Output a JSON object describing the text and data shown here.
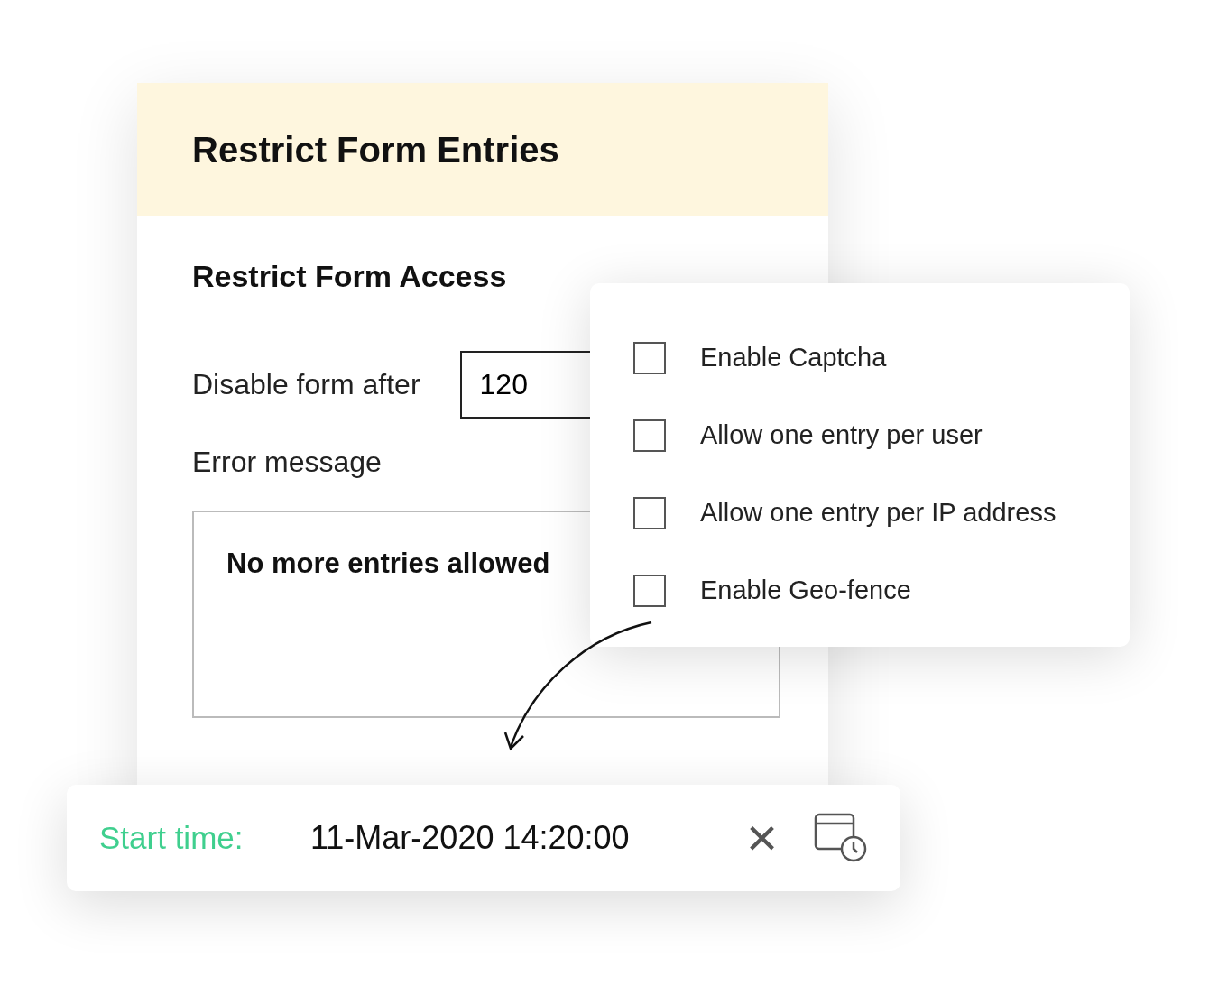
{
  "form_card": {
    "title": "Restrict Form Entries",
    "section_title": "Restrict Form Access",
    "limit_label": "Disable form after",
    "limit_value": "120",
    "error_label": "Error message",
    "error_value": "No more entries allowed"
  },
  "options": [
    {
      "label": "Enable Captcha",
      "checked": false
    },
    {
      "label": "Allow one entry per user",
      "checked": false
    },
    {
      "label": "Allow one entry per IP address",
      "checked": false
    },
    {
      "label": "Enable Geo-fence",
      "checked": false
    }
  ],
  "start_time": {
    "label": "Start time:",
    "value": "11-Mar-2020 14:20:00",
    "clear_symbol": "×"
  }
}
